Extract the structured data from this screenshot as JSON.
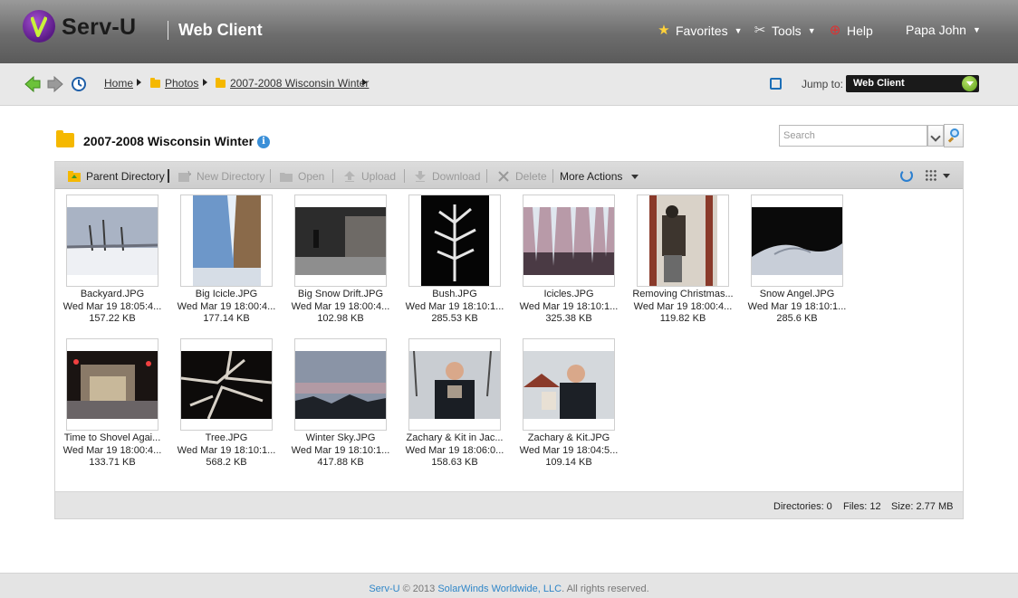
{
  "header": {
    "brand": "Serv-U",
    "app_name": "Web Client",
    "favorites": "Favorites",
    "tools": "Tools",
    "help": "Help",
    "user": "Papa John"
  },
  "breadcrumb": {
    "home": "Home",
    "photos": "Photos",
    "current": "2007-2008 Wisconsin Winter",
    "jump_label": "Jump to:",
    "jump_value": "Web Client"
  },
  "page": {
    "title": "2007-2008 Wisconsin Winter",
    "search_placeholder": "Search"
  },
  "toolbar": {
    "parent_directory": "Parent Directory",
    "new_directory": "New Directory",
    "open": "Open",
    "upload": "Upload",
    "download": "Download",
    "delete": "Delete",
    "more_actions": "More Actions"
  },
  "files": [
    {
      "name": "Backyard.JPG",
      "date": "Wed Mar 19 18:05:4...",
      "size": "157.22 KB"
    },
    {
      "name": "Big Icicle.JPG",
      "date": "Wed Mar 19 18:00:4...",
      "size": "177.14 KB"
    },
    {
      "name": "Big Snow Drift.JPG",
      "date": "Wed Mar 19 18:00:4...",
      "size": "102.98 KB"
    },
    {
      "name": "Bush.JPG",
      "date": "Wed Mar 19 18:10:1...",
      "size": "285.53 KB"
    },
    {
      "name": "Icicles.JPG",
      "date": "Wed Mar 19 18:10:1...",
      "size": "325.38 KB"
    },
    {
      "name": "Removing Christmas...",
      "date": "Wed Mar 19 18:00:4...",
      "size": "119.82 KB"
    },
    {
      "name": "Snow Angel.JPG",
      "date": "Wed Mar 19 18:10:1...",
      "size": "285.6 KB"
    },
    {
      "name": "Time to Shovel Agai...",
      "date": "Wed Mar 19 18:00:4...",
      "size": "133.71 KB"
    },
    {
      "name": "Tree.JPG",
      "date": "Wed Mar 19 18:10:1...",
      "size": "568.2 KB"
    },
    {
      "name": "Winter Sky.JPG",
      "date": "Wed Mar 19 18:10:1...",
      "size": "417.88 KB"
    },
    {
      "name": "Zachary & Kit in Jac...",
      "date": "Wed Mar 19 18:06:0...",
      "size": "158.63 KB"
    },
    {
      "name": "Zachary & Kit.JPG",
      "date": "Wed Mar 19 18:04:5...",
      "size": "109.14 KB"
    }
  ],
  "status": {
    "directories": "Directories: 0",
    "files": "Files: 12",
    "size": "Size: 2.77 MB"
  },
  "footer": {
    "product": "Serv-U",
    "copyright": " © 2013 ",
    "company": "SolarWinds Worldwide, LLC",
    "rights": ". All rights reserved."
  }
}
